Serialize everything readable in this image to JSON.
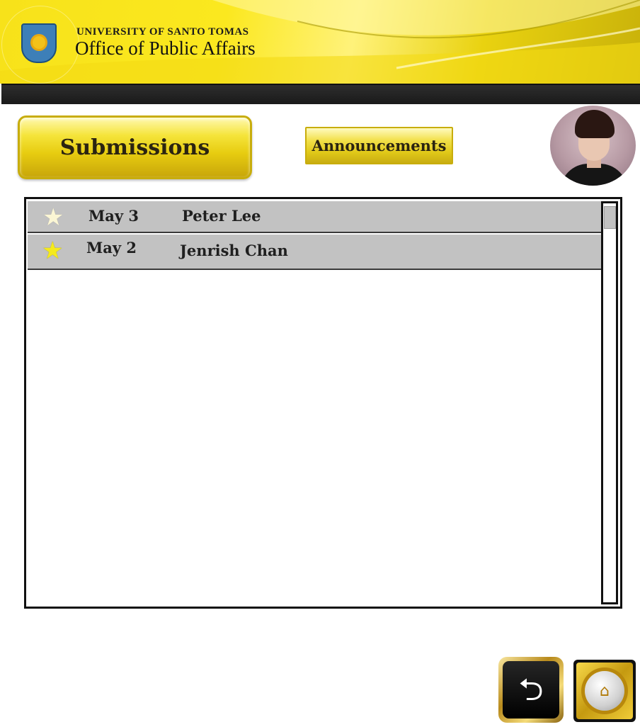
{
  "header": {
    "university": "UNIVERSITY OF SANTO TOMAS",
    "office": "Office of Public Affairs",
    "seal_icon": "university-seal-icon",
    "accent_color": "#f5e21a"
  },
  "tabs": {
    "submissions_label": "Submissions",
    "announcements_label": "Announcements"
  },
  "profile": {
    "avatar_icon": "user-avatar"
  },
  "submissions": {
    "rows": [
      {
        "date": "May 3",
        "name": "Peter Lee",
        "star_icon": "star-icon",
        "star_color": "#fbf6d4"
      },
      {
        "date": "May 2",
        "name": "Jenrish Chan",
        "star_icon": "star-icon",
        "star_color": "#f5ea1c"
      }
    ]
  },
  "footer": {
    "back_icon": "back-arrow-icon",
    "home_icon": "home-icon"
  }
}
